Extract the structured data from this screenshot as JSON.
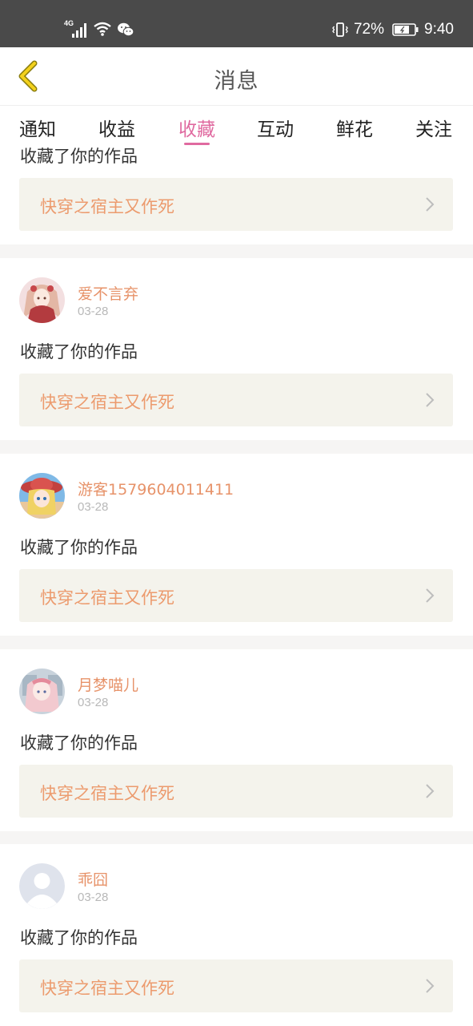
{
  "status_bar": {
    "network": "4G",
    "battery_percent": "72%",
    "time": "9:40",
    "icons": [
      "signal-icon",
      "wifi-icon",
      "wechat-icon",
      "vibrate-icon",
      "battery-icon"
    ]
  },
  "header": {
    "title": "消息",
    "back_icon": "chevron-left-icon"
  },
  "tabs": [
    {
      "label": "通知",
      "active": false
    },
    {
      "label": "收益",
      "active": false
    },
    {
      "label": "收藏",
      "active": true
    },
    {
      "label": "互动",
      "active": false
    },
    {
      "label": "鲜花",
      "active": false
    },
    {
      "label": "关注",
      "active": false
    }
  ],
  "colors": {
    "accent": "#e06aa0",
    "username": "#e7936a",
    "work_title": "#ec9b6e",
    "link_bg": "#f4f3ec",
    "status_bar_bg": "#4a4a4a"
  },
  "messages": [
    {
      "username": "",
      "date": "",
      "action": "收藏了你的作品",
      "work_title": "快穿之宿主又作死",
      "avatar": "partial"
    },
    {
      "username": "爱不言弃",
      "date": "03-28",
      "action": "收藏了你的作品",
      "work_title": "快穿之宿主又作死",
      "avatar": "anime-avatar-red"
    },
    {
      "username": "游客1579604011411",
      "date": "03-28",
      "action": "收藏了你的作品",
      "work_title": "快穿之宿主又作死",
      "avatar": "anime-avatar-hat"
    },
    {
      "username": "月梦喵儿",
      "date": "03-28",
      "action": "收藏了你的作品",
      "work_title": "快穿之宿主又作死",
      "avatar": "anime-avatar-blue"
    },
    {
      "username": "乖囧",
      "date": "03-28",
      "action": "收藏了你的作品",
      "work_title": "快穿之宿主又作死",
      "avatar": "default-avatar"
    }
  ]
}
